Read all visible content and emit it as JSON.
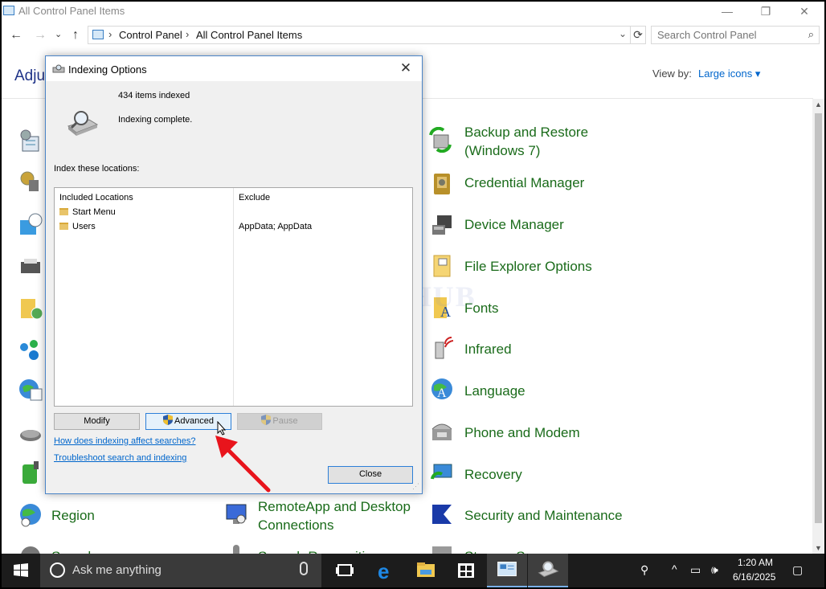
{
  "window": {
    "title": "All Control Panel Items",
    "minimize": "—",
    "maximize": "❐",
    "close": "✕"
  },
  "nav": {
    "back": "←",
    "forward": "→",
    "recent": "⌄",
    "up": "↑",
    "breadcrumb": [
      "Control Panel",
      "All Control Panel Items"
    ],
    "search_placeholder": "Search Control Panel"
  },
  "main": {
    "heading": "Adjus",
    "view_by_label": "View by:",
    "view_by_value": "Large icons ▾"
  },
  "items": {
    "backup": "Backup and Restore",
    "backup2": "(Windows 7)",
    "credential": "Credential Manager",
    "device": "Device Manager",
    "file_explorer": "File Explorer Options",
    "fonts": "Fonts",
    "infrared": "Infrared",
    "language": "Language",
    "phone": "Phone and Modem",
    "recovery": "Recovery",
    "region": "Region",
    "remoteapp": "RemoteApp and Desktop",
    "remoteapp2": "Connections",
    "security": "Security and Maintenance",
    "partial_sound": "Sound",
    "partial_speech": "Speech Recognition",
    "partial_storage": "Storage Spaces"
  },
  "dialog": {
    "title": "Indexing Options",
    "items_indexed": "434 items indexed",
    "status": "Indexing complete.",
    "index_label": "Index these locations:",
    "col_included": "Included Locations",
    "col_exclude": "Exclude",
    "locations": [
      {
        "name": "Start Menu",
        "exclude": ""
      },
      {
        "name": "Users",
        "exclude": "AppData; AppData"
      }
    ],
    "modify": "Modify",
    "advanced": "Advanced",
    "pause": "Pause",
    "link_how": "How does indexing affect searches?",
    "link_troubleshoot": "Troubleshoot search and indexing",
    "close": "Close"
  },
  "watermark": "IT Pros HUB",
  "taskbar": {
    "search_text": "Ask me anything",
    "time": "1:20 AM",
    "date": "6/16/2025"
  },
  "colors": {
    "link": "#0066cc",
    "item_green": "#1a6b1a",
    "heading_blue": "#1e3287",
    "annotation_red": "#e8141c"
  }
}
